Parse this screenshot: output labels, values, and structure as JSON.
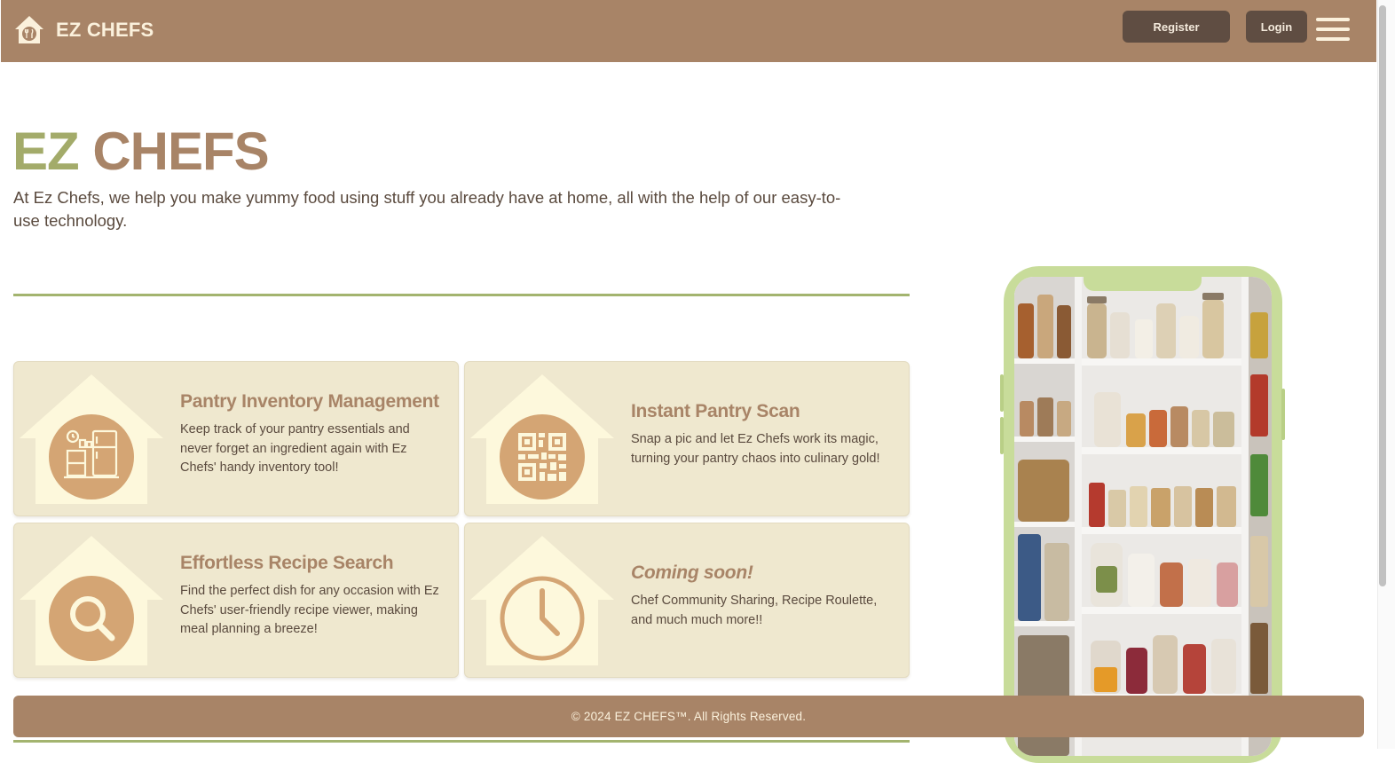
{
  "header": {
    "brand": "EZ CHEFS",
    "register_label": "Register",
    "login_label": "Login",
    "logo_icon": "house-chef-icon",
    "menu_icon": "hamburger-menu-icon"
  },
  "hero": {
    "title_part1": "EZ",
    "title_part2": "CHEFS",
    "description": "At Ez Chefs, we help you make yummy food using stuff you already have at home, all with the help of our easy-to-use technology."
  },
  "features": [
    {
      "title": "Pantry Inventory Management",
      "description": "Keep track of your pantry essentials and never forget an ingredient again with Ez Chefs' handy inventory tool!",
      "icon": "pantry-inventory-icon"
    },
    {
      "title": "Instant Pantry Scan",
      "description": "Snap a pic and let Ez Chefs work its magic, turning your pantry chaos into culinary gold!",
      "icon": "qr-code-icon"
    },
    {
      "title": "Effortless Recipe Search",
      "description": "Find the perfect dish for any occasion with Ez Chefs' user-friendly recipe viewer, making meal planning a breeze!",
      "icon": "search-icon"
    },
    {
      "title": "Coming soon!",
      "description": "Chef Community Sharing, Recipe Roulette, and much much more!!",
      "icon": "clock-icon"
    }
  ],
  "footer": {
    "copyright": "© 2024 EZ CHEFS™. All Rights Reserved."
  },
  "colors": {
    "brand_brown": "#a88467",
    "accent_green": "#a3ab6a",
    "button_dark": "#5f4d42",
    "card_bg": "#efe8cf",
    "house_cream": "#fdf8dc",
    "icon_circle": "#d4a574"
  }
}
